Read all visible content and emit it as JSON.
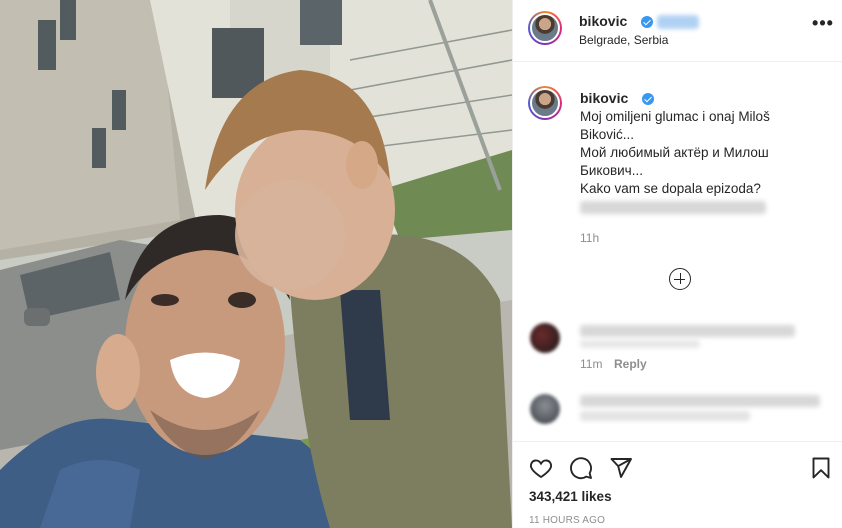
{
  "post": {
    "username": "bikovic",
    "location": "Belgrade, Serbia",
    "more_label": "•••",
    "caption": {
      "username": "bikovic",
      "lines": [
        "Moj omiljeni glumac i onaj Miloš",
        "Biković...",
        "Мой любимый актёр и Милош",
        "Бикович...",
        "Kako vam se dopala epizoda?"
      ],
      "time": "11h"
    },
    "comments": [
      {
        "time": "11m",
        "reply_label": "Reply"
      }
    ],
    "likes": "343,421 likes",
    "posted_ago": "11 HOURS AGO",
    "icons": {
      "like": "heart-icon",
      "comment": "comment-bubble-icon",
      "share": "paper-plane-icon",
      "save": "bookmark-icon",
      "load_more": "plus-circle-icon",
      "verified": "verified-badge-icon"
    },
    "colors": {
      "verified": "#3897f0",
      "text": "#262626",
      "muted": "#8e8e8e",
      "border": "#efefef"
    }
  }
}
